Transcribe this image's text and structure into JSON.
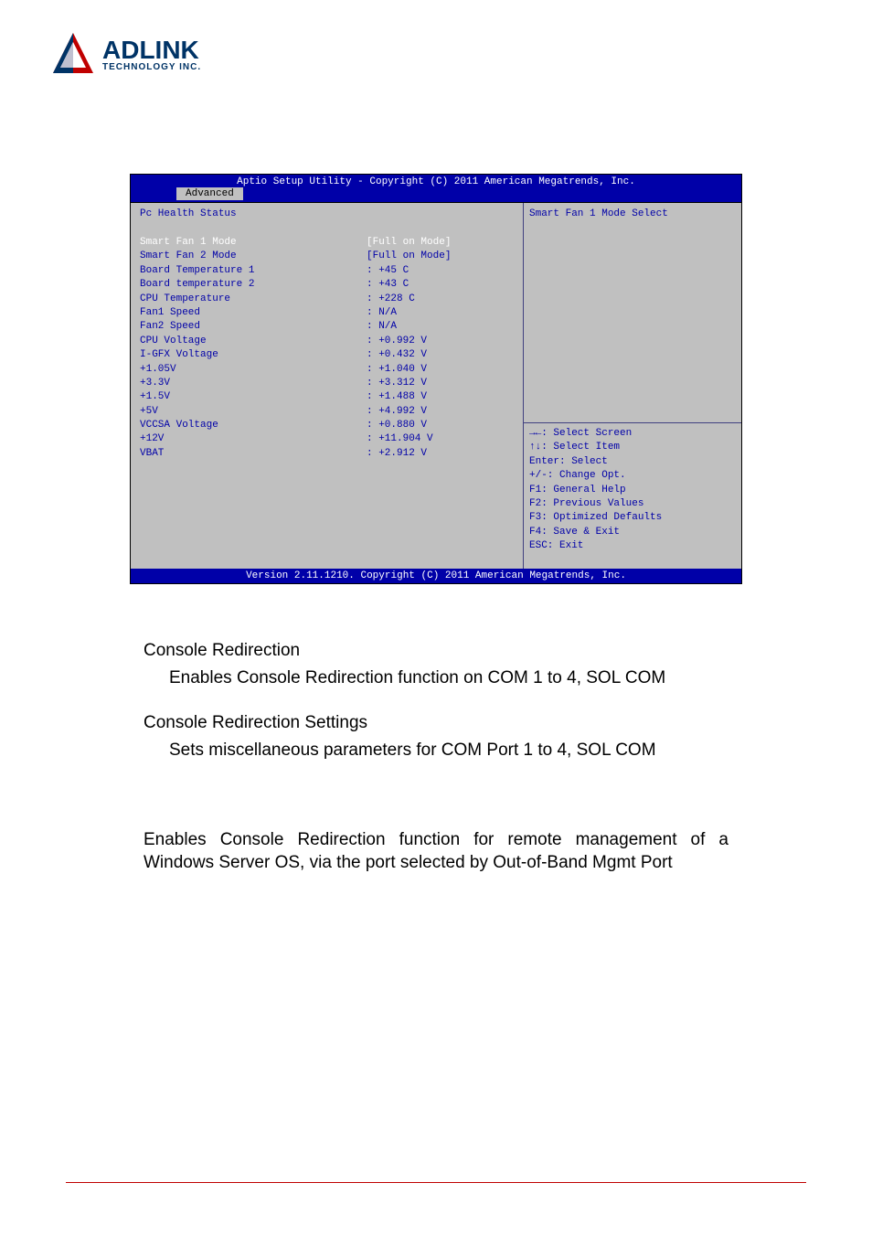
{
  "logo": {
    "main": "ADLINK",
    "sub": "TECHNOLOGY INC."
  },
  "bios": {
    "header": "Aptio Setup Utility - Copyright (C) 2011 American Megatrends, Inc.",
    "tab": "Advanced",
    "section_title": "Pc Health Status",
    "rows": [
      {
        "label": "Smart Fan 1 Mode",
        "value": "[Full on Mode]",
        "selected": true
      },
      {
        "label": "Smart Fan 2 Mode",
        "value": "[Full on Mode]"
      },
      {
        "label": "Board Temperature 1",
        "value": ": +45 C"
      },
      {
        "label": "Board temperature 2",
        "value": ": +43 C"
      },
      {
        "label": "CPU Temperature",
        "value": ": +228 C"
      },
      {
        "label": "Fan1 Speed",
        "value": ": N/A"
      },
      {
        "label": "Fan2 Speed",
        "value": ": N/A"
      },
      {
        "label": "CPU Voltage",
        "value": ": +0.992 V"
      },
      {
        "label": "I-GFX Voltage",
        "value": ": +0.432 V"
      },
      {
        "label": "+1.05V",
        "value": ": +1.040 V"
      },
      {
        "label": "+3.3V",
        "value": ": +3.312 V"
      },
      {
        "label": "+1.5V",
        "value": ": +1.488 V"
      },
      {
        "label": "+5V",
        "value": ": +4.992 V"
      },
      {
        "label": "VCCSA Voltage",
        "value": ": +0.880 V"
      },
      {
        "label": "+12V",
        "value": ": +11.904 V"
      },
      {
        "label": "VBAT",
        "value": ": +2.912 V"
      }
    ],
    "help_title": "Smart Fan 1 Mode Select",
    "hints": [
      "→←: Select Screen",
      "↑↓: Select Item",
      "Enter: Select",
      "+/-: Change Opt.",
      "F1: General Help",
      "F2: Previous Values",
      "F3: Optimized Defaults",
      "F4: Save & Exit",
      "ESC: Exit"
    ],
    "footer": "Version 2.11.1210. Copyright (C) 2011 American Megatrends, Inc."
  },
  "doc": {
    "h1": "Console Redirection",
    "p1": "Enables Console Redirection function on COM 1 to 4, SOL COM",
    "h2": "Console Redirection Settings",
    "p2": "Sets miscellaneous parameters for COM Port 1 to 4, SOL COM",
    "p3": "Enables Console Redirection function for remote management of a Windows Server OS, via the port selected by Out-of-Band Mgmt Port"
  }
}
